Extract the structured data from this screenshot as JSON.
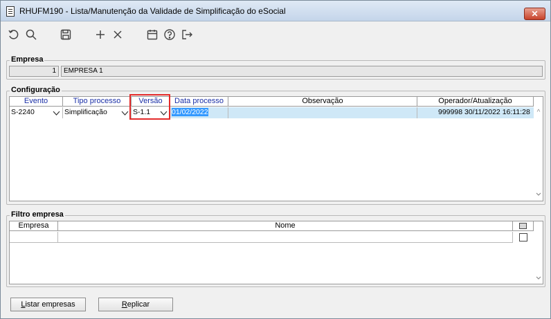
{
  "window": {
    "title": "RHUFM190 - Lista/Manutenção da Validade de Simplificação do eSocial"
  },
  "toolbar": {
    "icons": [
      "undo-icon",
      "search-icon",
      "save-icon",
      "add-icon",
      "delete-icon",
      "calendar-icon",
      "help-icon",
      "exit-icon"
    ]
  },
  "empresa": {
    "title": "Empresa",
    "code": "1",
    "name": "EMPRESA 1"
  },
  "configuracao": {
    "title": "Configuração",
    "headers": {
      "evento": "Evento",
      "tipo": "Tipo processo",
      "versao": "Versão",
      "data": "Data processo",
      "obs": "Observação",
      "operador": "Operador/Atualização"
    },
    "row": {
      "evento": "S-2240",
      "tipo": "Simplificação",
      "versao": "S-1.1",
      "data": "01/02/2022",
      "obs": "",
      "operador_id": "999998",
      "atualizacao": "30/11/2022 16:11:28"
    }
  },
  "filtro": {
    "title": "Filtro empresa",
    "headers": {
      "empresa": "Empresa",
      "nome": "Nome"
    }
  },
  "buttons": {
    "listar_first": "L",
    "listar_rest": "istar empresas",
    "replicar_first": "R",
    "replicar_rest": "eplicar"
  },
  "colors": {
    "highlight": "#e32a2a",
    "selected_row": "#cfe8f7",
    "header_text": "#1a2fa6",
    "date_selection": "#3399ff"
  }
}
